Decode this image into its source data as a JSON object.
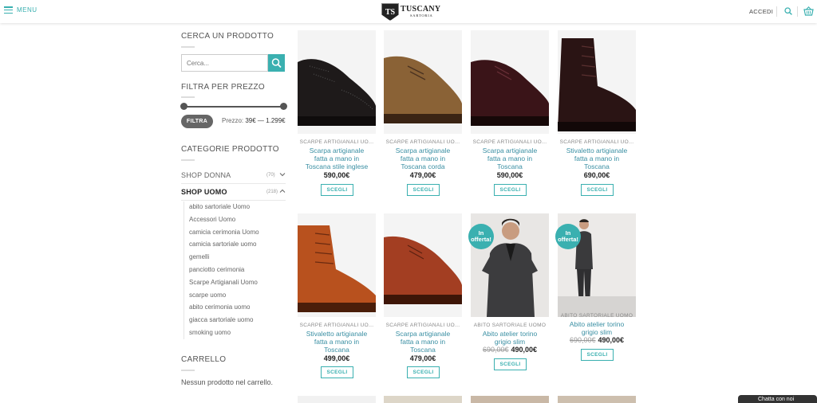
{
  "header": {
    "menu_label": "MENU",
    "logo_mark": "TS",
    "logo_brand": "TUSCANY",
    "logo_sub": "SARTORIA",
    "login_label": "ACCEDI"
  },
  "sidebar": {
    "search_heading": "CERCA UN PRODOTTO",
    "search_placeholder": "Cerca...",
    "price_heading": "FILTRA PER PREZZO",
    "filter_button": "FILTRA",
    "price_label": "Prezzo:",
    "price_range": "39€ — 1.299€",
    "categories_heading": "CATEGORIE PRODOTTO",
    "categories": [
      {
        "name": "SHOP DONNA",
        "count": "(70)"
      },
      {
        "name": "SHOP UOMO",
        "count": "(218)"
      }
    ],
    "subcategories": [
      "abito sartoriale Uomo",
      "Accessori Uomo",
      "camicia cerimonia Uomo",
      "camicia sartoriale uomo",
      "gemelli",
      "panciotto cerimonia",
      "Scarpe Artigianali Uomo",
      "scarpe uomo",
      "abito cerimonia uomo",
      "giacca sartoriale uomo",
      "smoking uomo"
    ],
    "cart_heading": "CARRELLO",
    "cart_empty": "Nessun prodotto nel carrello."
  },
  "products": [
    {
      "category": "SCARPE ARTIGIANALI UO...",
      "title_lines": [
        "Scarpa artigianale",
        "fatta a mano in",
        "Toscana stile inglese"
      ],
      "price": "590,00€",
      "button": "SCEGLI"
    },
    {
      "category": "SCARPE ARTIGIANALI UO...",
      "title_lines": [
        "Scarpa artigianale",
        "fatta a mano in",
        "Toscana corda"
      ],
      "price": "479,00€",
      "button": "SCEGLI"
    },
    {
      "category": "SCARPE ARTIGIANALI UO...",
      "title_lines": [
        "Scarpa artigianale",
        "fatta a mano in",
        "Toscana"
      ],
      "price": "590,00€",
      "button": "SCEGLI"
    },
    {
      "category": "SCARPE ARTIGIANALI UO...",
      "title_lines": [
        "Stivaletto artigianale",
        "fatta a mano in",
        "Toscana"
      ],
      "price": "690,00€",
      "button": "SCEGLI"
    },
    {
      "category": "SCARPE ARTIGIANALI UO...",
      "title_lines": [
        "Stivaletto artigianale",
        "fatta a mano in",
        "Toscana"
      ],
      "price": "499,00€",
      "button": "SCEGLI"
    },
    {
      "category": "SCARPE ARTIGIANALI UO...",
      "title_lines": [
        "Scarpa artigianale",
        "fatta a mano in",
        "Toscana"
      ],
      "price": "479,00€",
      "button": "SCEGLI"
    },
    {
      "category": "ABITO SARTORIALE UOMO",
      "title_lines": [
        "Abito atelier torino",
        "grigio slim"
      ],
      "old_price": "690,00€",
      "price": "490,00€",
      "badge": "In offerta!",
      "button": "SCEGLI"
    },
    {
      "category": "ABITO SARTORIALE UOMO",
      "title_lines": [
        "Abito atelier torino",
        "grigio slim"
      ],
      "old_price": "690,00€",
      "price": "490,00€",
      "badge": "In offerta!",
      "button": "SCEGLI"
    }
  ],
  "chat_label": "Chatta con noi",
  "colors": {
    "accent": "#3ab0b0",
    "link": "#3a8fa3"
  }
}
